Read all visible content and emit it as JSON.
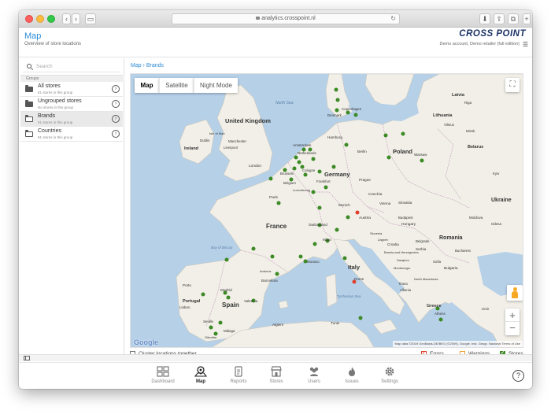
{
  "browser": {
    "url": "analytics.crosspoint.nl"
  },
  "header": {
    "title": "Map",
    "subtitle": "Overview of store locations",
    "brand": "CROSS POINT",
    "account": "Demo account, Demo retailer (full edition)"
  },
  "sidebar": {
    "search_placeholder": "Search",
    "groups_label": "Groups",
    "items": [
      {
        "name": "All stores",
        "sub": "51 stores in this group",
        "selected": false
      },
      {
        "name": "Ungrouped stores",
        "sub": "No stores in this group",
        "selected": false
      },
      {
        "name": "Brands",
        "sub": "51 stores in this group",
        "selected": true
      },
      {
        "name": "Countries",
        "sub": "51 stores in this group",
        "selected": false
      }
    ]
  },
  "main": {
    "breadcrumb": "Map › Brands",
    "map_types": [
      "Map",
      "Satellite",
      "Night Mode"
    ],
    "active_map_type": "Map",
    "google_logo": "Google",
    "attribution": "Map data ©2019 GeoBasis-DE/BKG (©2009), Google, Inst. Geogr. Nacional   Terms of Use",
    "labels": {
      "sea_north": "North Sea",
      "sea_bay": "Bay of Biscay",
      "sea_tyrr": "Tyrrhenian Sea",
      "uk": "United Kingdom",
      "ireland": "Ireland",
      "france": "France",
      "spain": "Spain",
      "portugal": "Portugal",
      "germany": "Germany",
      "poland": "Poland",
      "italy": "Italy",
      "ukraine": "Ukraine",
      "romania": "Romania",
      "latvia": "Latvia",
      "lithuania": "Lithuania",
      "belarus": "Belarus",
      "czechia": "Czechia",
      "austria": "Austria",
      "hungary": "Hungary",
      "switzerland": "Switzerland",
      "slovakia": "Slovakia",
      "serbia": "Serbia",
      "bulgaria": "Bulgaria",
      "croatia": "Croatia",
      "greece": "Greece",
      "moldova": "Moldova",
      "denmark": "Denmark",
      "netherlands": "Netherlands",
      "belgium": "Belgium",
      "luxembourg": "Luxembourg",
      "edinburgh": "Edinburgh",
      "dublin": "Dublin",
      "manchester": "Manchester",
      "liverpool": "Liverpool",
      "london": "London",
      "isle_of_man": "Isle of Man",
      "amsterdam": "Amsterdam",
      "brussels": "Brussels",
      "cologne": "Cologne",
      "frankfurt": "Frankfurt",
      "hamburg": "Hamburg",
      "berlin": "Berlin",
      "copenhagen": "Copenhagen",
      "warsaw": "Warsaw",
      "prague": "Prague",
      "munich": "Munich",
      "vienna": "Vienna",
      "paris": "Paris",
      "milan": "Milan",
      "monaco": "Monaco",
      "rome": "Rome",
      "madrid": "Madrid",
      "barcelona": "Barcelona",
      "valencia": "Valencia",
      "lisbon": "Lisbon",
      "porto": "Porto",
      "seville": "Seville",
      "malaga": "Málaga",
      "gibraltar": "Gibraltar",
      "andorra": "Andorra",
      "algiers": "Algiers",
      "tunis": "Tunis",
      "riga": "Riga",
      "vilnius": "Vilnius",
      "minsk": "Minsk",
      "kyiv": "Kyiv",
      "odesa": "Odesa",
      "budapest": "Budapest",
      "belgrade": "Belgrade",
      "bucharest": "Bucharest",
      "sofia": "Sofia",
      "athens": "Athens",
      "izmir": "Izmir",
      "tirana": "Tirana",
      "albania": "Albania",
      "montenegro": "Montenegro",
      "slovenia": "Slovenia",
      "bosnia": "Bosnia and Herzegovina",
      "north_macedonia": "North Macedonia",
      "sarajevo": "Sarajevo",
      "zagreb": "Zagreb"
    }
  },
  "footer": {
    "cluster_label": "Cluster locations together",
    "legend": [
      {
        "label": "Errors",
        "color": "#e0402c"
      },
      {
        "label": "Warnings",
        "color": "#f0a030"
      },
      {
        "label": "Stores",
        "color": "#3c8a25"
      }
    ]
  },
  "nav": {
    "items": [
      {
        "label": "Dashboard",
        "icon": "dashboard-icon"
      },
      {
        "label": "Map",
        "icon": "map-icon"
      },
      {
        "label": "Reports",
        "icon": "reports-icon"
      },
      {
        "label": "Stores",
        "icon": "stores-icon"
      },
      {
        "label": "Users",
        "icon": "users-icon"
      },
      {
        "label": "Issues",
        "icon": "issues-icon"
      },
      {
        "label": "Settings",
        "icon": "settings-icon"
      }
    ],
    "active": "Map",
    "help": "?"
  },
  "colors": {
    "accent": "#2b8bd6",
    "brand": "#1b3266",
    "water": "#b6d0e8",
    "land": "#f1efe7",
    "store": "#3c8a25",
    "error": "#e0402c"
  }
}
